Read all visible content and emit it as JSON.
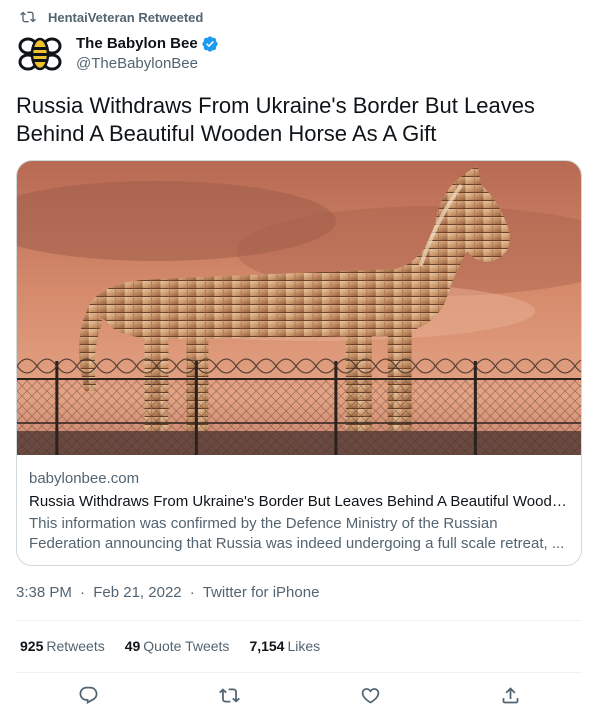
{
  "retweet": {
    "text": "HentaiVeteran Retweeted"
  },
  "author": {
    "name": "The Babylon Bee",
    "handle": "@TheBabylonBee"
  },
  "tweet": {
    "text": "Russia Withdraws From Ukraine's Border But Leaves Behind A Beautiful Wooden Horse As A Gift"
  },
  "card": {
    "domain": "babylonbee.com",
    "title": "Russia Withdraws From Ukraine's Border But Leaves Behind A Beautiful Woode...",
    "description": "This information was confirmed by the Defence Ministry of the Russian Federation announcing that Russia was indeed undergoing a full scale retreat, ...",
    "image_alt": "wooden horse behind barbed wire fence at sunset"
  },
  "meta": {
    "time": "3:38 PM",
    "separator": "·",
    "date": "Feb 21, 2022",
    "source": "Twitter for iPhone"
  },
  "stats": {
    "retweets_count": "925",
    "retweets_label": "Retweets",
    "quotes_count": "49",
    "quotes_label": "Quote Tweets",
    "likes_count": "7,154",
    "likes_label": "Likes"
  },
  "colors": {
    "text": "#0f1419",
    "secondary": "#536471",
    "border": "#cfd9de",
    "verified": "#1d9bf0",
    "bee_yellow": "#f2c12e"
  },
  "icons": [
    "retweet-icon",
    "bee-logo-icon",
    "verified-badge-icon",
    "reply-icon",
    "like-icon",
    "share-icon"
  ]
}
